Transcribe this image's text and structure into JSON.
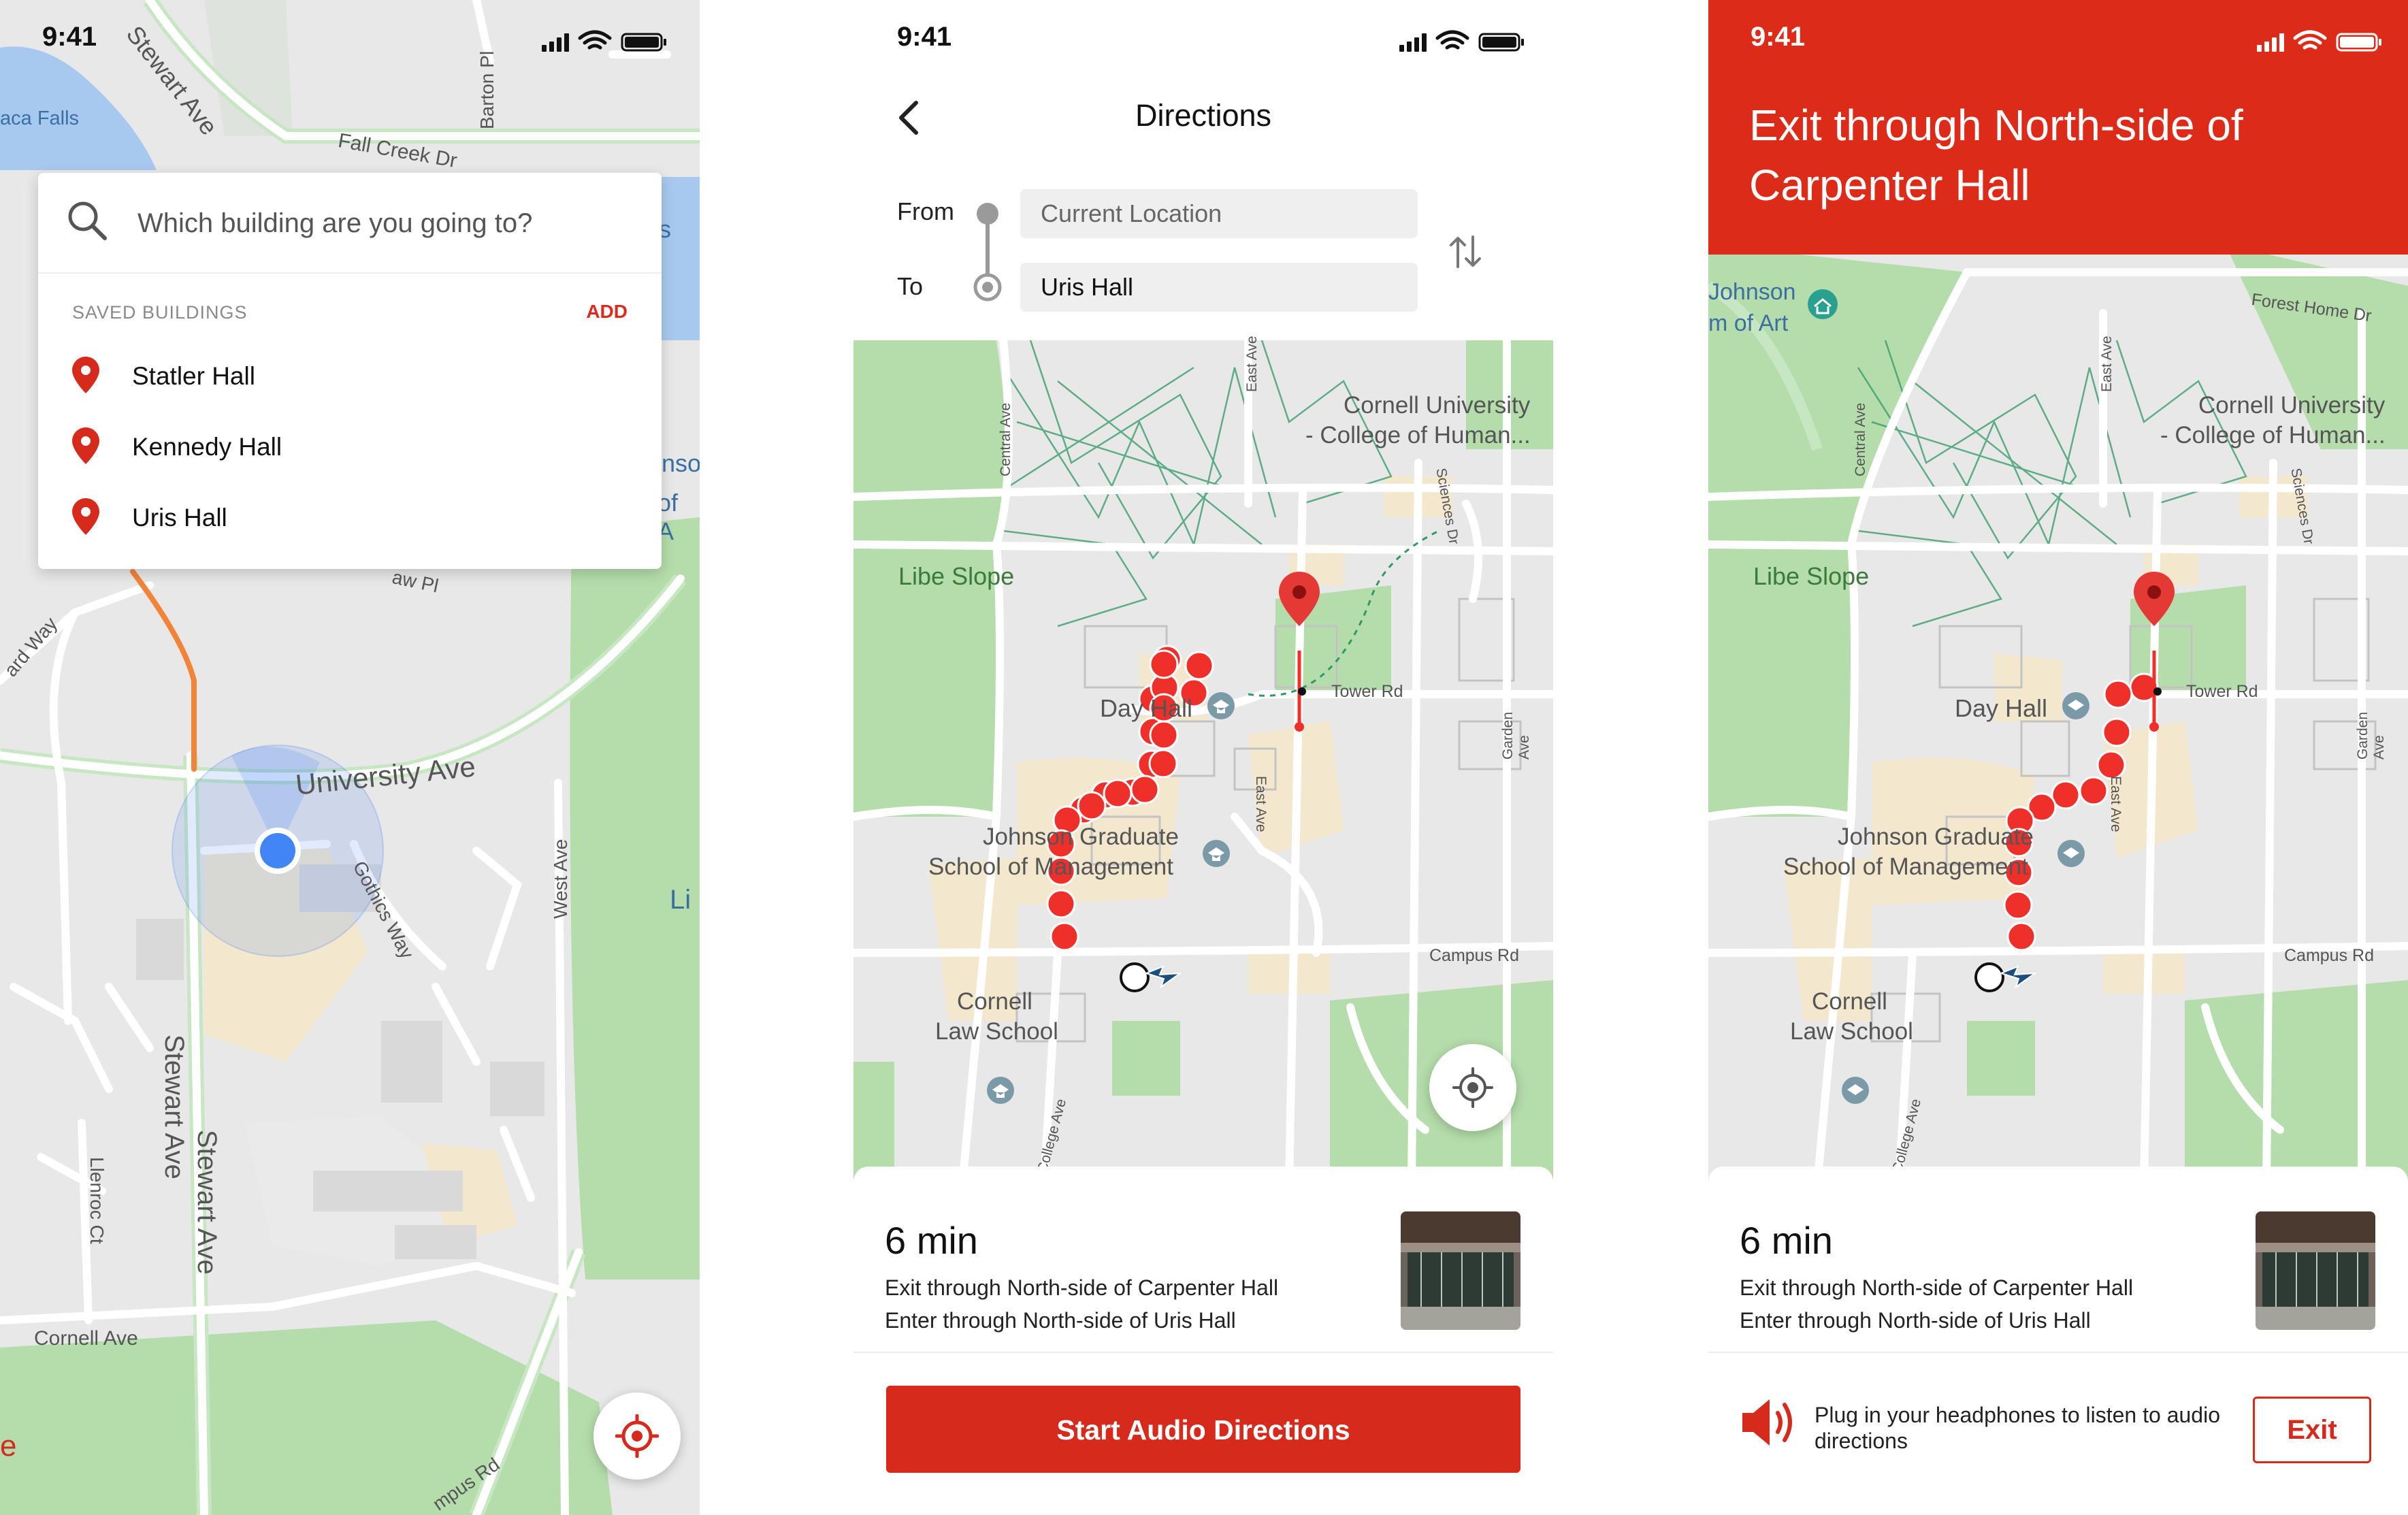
{
  "colors": {
    "brand_red": "#d62b1c",
    "header_red": "#dd2b1a",
    "route_dot": "#ef2f2a",
    "map_bg": "#e8e8e8",
    "park_green": "#b5dcab",
    "campus_tan": "#f3e7cd",
    "user_location_blue": "#4285f4"
  },
  "screens": {
    "search": {
      "status": {
        "time": "9:41"
      },
      "search": {
        "placeholder": "Which building are you going to?"
      },
      "saved": {
        "header": "SAVED BUILDINGS",
        "add_label": "ADD",
        "items": [
          {
            "label": "Statler Hall",
            "icon": "map-pin-icon"
          },
          {
            "label": "Kennedy Hall",
            "icon": "map-pin-icon"
          },
          {
            "label": "Uris Hall",
            "icon": "map-pin-icon"
          }
        ]
      },
      "map_labels": {
        "stewart_top": "Stewart Ave",
        "barton": "Barton Pl",
        "falls": "aca Falls",
        "fall_creek": "Fall Creek Dr",
        "s_fragment": "s",
        "johnson_fragment": "nso",
        "of_fragment": "of A",
        "aw_pl": "aw Pl",
        "ard_way": "ard Way",
        "university_ave": "University Ave",
        "gothics_way": "Gothics Way",
        "west_ave": "West Ave",
        "li_fragment": "Li",
        "stewart_mid": "Stewart Ave",
        "stewart_low": "Stewart Ave",
        "llenroc": "Llenroc Ct",
        "cornell_ave": "Cornell Ave",
        "campus_rd_fragment": "mpus Rd",
        "e_fragment": "e"
      },
      "locate_icon": "crosshair-icon"
    },
    "directions": {
      "status": {
        "time": "9:41"
      },
      "nav": {
        "title": "Directions",
        "back_icon": "chevron-left-icon"
      },
      "route": {
        "from_label": "From",
        "to_label": "To",
        "from_value": "Current Location",
        "to_value": "Uris Hall",
        "swap_icon": "swap-arrows-icon"
      },
      "map_labels": {
        "cornell_university": "Cornell University",
        "college_of_human": "- College of Human...",
        "libe_slope": "Libe Slope",
        "day_hall": "Day Hall",
        "tower_rd": "Tower Rd",
        "johnson_grad": "Johnson Graduate",
        "school_mgmt": "School of Management",
        "cornell": "Cornell",
        "law_school": "Law School",
        "campus_rd": "Campus Rd",
        "central_ave": "Central Ave",
        "east_ave_top": "East Ave",
        "east_ave_mid": "East Ave",
        "sciences_dr": "Sciences Dr",
        "garden_ave": "Garden Ave",
        "college_ave": "College Ave"
      },
      "summary": {
        "eta": "6 min",
        "step1": "Exit through North-side of Carpenter Hall",
        "step2": "Enter through North-side of Uris Hall",
        "thumb_label": "building-entrance-photo"
      },
      "start_button": "Start Audio Directions"
    },
    "navigating": {
      "status": {
        "time": "9:41"
      },
      "instruction": "Exit through North-side of Carpenter Hall",
      "map_labels": {
        "johnson_museum": "Johnson",
        "museum_art": "m of Art",
        "forest_home": "Forest Home Dr",
        "cornell_university": "Cornell University",
        "college_of_human": "- College of Human...",
        "libe_slope": "Libe Slope",
        "day_hall": "Day Hall",
        "tower_rd": "Tower Rd",
        "johnson_grad": "Johnson Graduate",
        "school_mgmt": "School of Management",
        "cornell": "Cornell",
        "law_school": "Law School",
        "campus_rd": "Campus Rd",
        "central_ave": "Central Ave",
        "east_ave_top": "East Ave",
        "east_ave_mid": "East Ave",
        "sciences_dr": "Sciences Dr",
        "garden_ave": "Garden Ave",
        "college_ave": "College Ave"
      },
      "summary": {
        "eta": "6 min",
        "step1": "Exit through North-side of Carpenter Hall",
        "step2": "Enter through North-side of Uris Hall",
        "thumb_label": "building-entrance-photo"
      },
      "audio": {
        "icon": "speaker-icon",
        "text": "Plug in your headphones to listen to audio directions",
        "exit_label": "Exit"
      }
    }
  }
}
